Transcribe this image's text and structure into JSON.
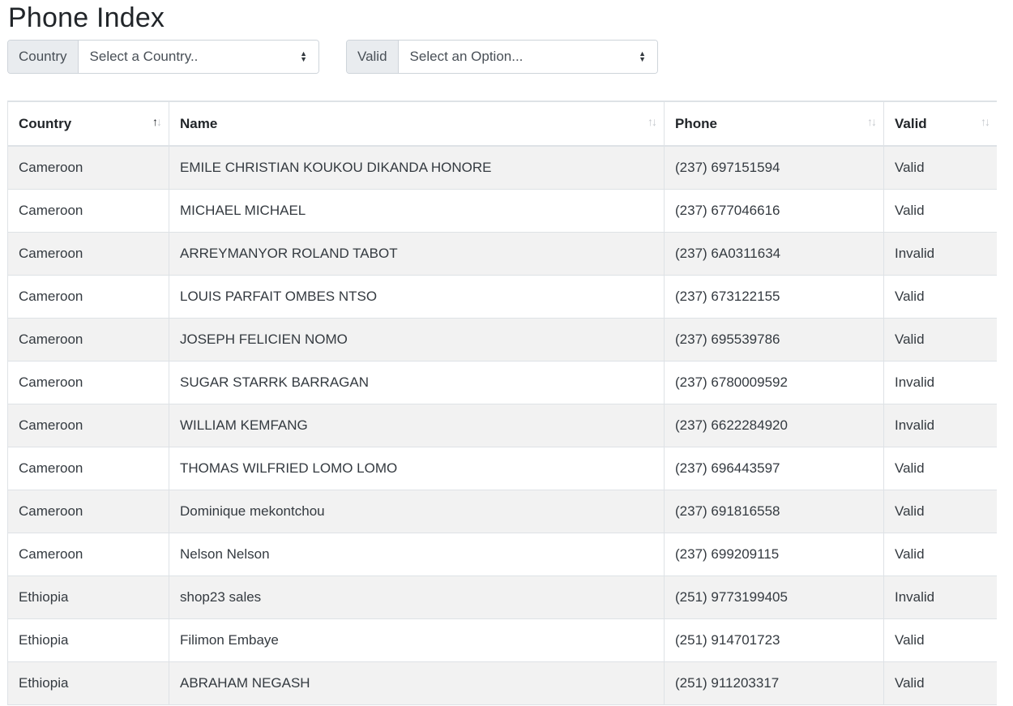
{
  "page": {
    "title": "Phone Index"
  },
  "filters": {
    "country": {
      "label": "Country",
      "placeholder": "Select a Country.."
    },
    "valid": {
      "label": "Valid",
      "placeholder": "Select an Option..."
    }
  },
  "table": {
    "columns": [
      "Country",
      "Name",
      "Phone",
      "Valid"
    ],
    "sorted_column": "Country",
    "rows": [
      {
        "country": "Cameroon",
        "name": "EMILE CHRISTIAN KOUKOU DIKANDA HONORE",
        "phone": "(237) 697151594",
        "valid": "Valid"
      },
      {
        "country": "Cameroon",
        "name": "MICHAEL MICHAEL",
        "phone": "(237) 677046616",
        "valid": "Valid"
      },
      {
        "country": "Cameroon",
        "name": "ARREYMANYOR ROLAND TABOT",
        "phone": "(237) 6A0311634",
        "valid": "Invalid"
      },
      {
        "country": "Cameroon",
        "name": "LOUIS PARFAIT OMBES NTSO",
        "phone": "(237) 673122155",
        "valid": "Valid"
      },
      {
        "country": "Cameroon",
        "name": "JOSEPH FELICIEN NOMO",
        "phone": "(237) 695539786",
        "valid": "Valid"
      },
      {
        "country": "Cameroon",
        "name": "SUGAR STARRK BARRAGAN",
        "phone": "(237) 6780009592",
        "valid": "Invalid"
      },
      {
        "country": "Cameroon",
        "name": "WILLIAM KEMFANG",
        "phone": "(237) 6622284920",
        "valid": "Invalid"
      },
      {
        "country": "Cameroon",
        "name": "THOMAS WILFRIED LOMO LOMO",
        "phone": "(237) 696443597",
        "valid": "Valid"
      },
      {
        "country": "Cameroon",
        "name": "Dominique mekontchou",
        "phone": "(237) 691816558",
        "valid": "Valid"
      },
      {
        "country": "Cameroon",
        "name": "Nelson Nelson",
        "phone": "(237) 699209115",
        "valid": "Valid"
      },
      {
        "country": "Ethiopia",
        "name": "shop23 sales",
        "phone": "(251) 9773199405",
        "valid": "Invalid"
      },
      {
        "country": "Ethiopia",
        "name": "Filimon Embaye",
        "phone": "(251) 914701723",
        "valid": "Valid"
      },
      {
        "country": "Ethiopia",
        "name": "ABRAHAM NEGASH",
        "phone": "(251) 911203317",
        "valid": "Valid"
      }
    ]
  }
}
